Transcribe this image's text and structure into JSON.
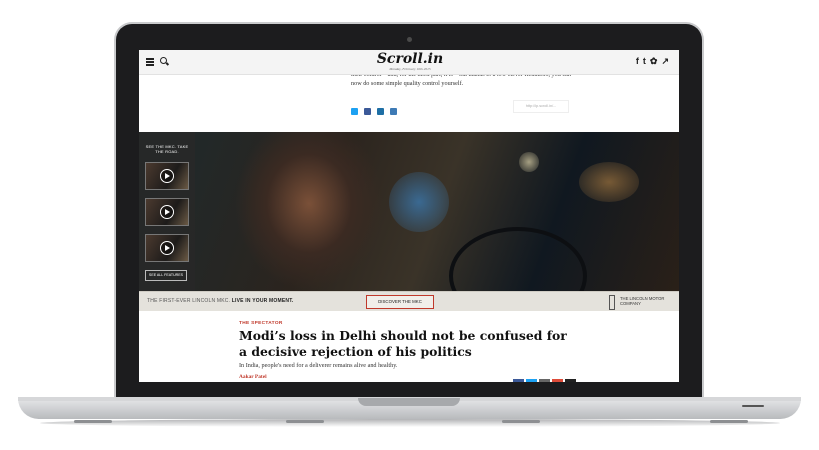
{
  "site": {
    "logo": "Scroll.in",
    "date": "Monday, February 16th 2015"
  },
  "article_top": {
    "text": "their control—and, for the most part, it is—but thanks to a few clever Redditors, you can now do some simple quality control yourself.",
    "short_url": "http://ip.scroll.in/..."
  },
  "ad": {
    "side_title": "SEE THE MKC. TAKE THE ROAD.",
    "see_all": "SEE ALL FEATURES",
    "footer_text": "THE FIRST-EVER LINCOLN MKC.",
    "footer_tagline": "LIVE IN YOUR MOMENT.",
    "cta": "DISCOVER THE MKC",
    "brand": "THE LINCOLN MOTOR COMPANY"
  },
  "article": {
    "kicker": "THE SPECTATOR",
    "headline": "Modi’s loss in Delhi should not be confused for a decisive rejection of his politics",
    "dek": "In India, people's need for a deliverer remains alive and healthy.",
    "byline": "Aakar Patel"
  },
  "icons": {
    "top_social": [
      "facebook-icon",
      "twitter-icon",
      "settings-icon",
      "trending-icon"
    ],
    "share_top": [
      "twitter-icon",
      "facebook-icon",
      "linkedin-icon",
      "email-icon"
    ],
    "share_bottom": [
      "facebook-icon",
      "twitter-icon",
      "email-icon",
      "googleplus-icon",
      "reddit-icon"
    ]
  },
  "colors": {
    "accent": "#c0392b",
    "twitter": "#1da1f2",
    "facebook": "#3b5998"
  }
}
